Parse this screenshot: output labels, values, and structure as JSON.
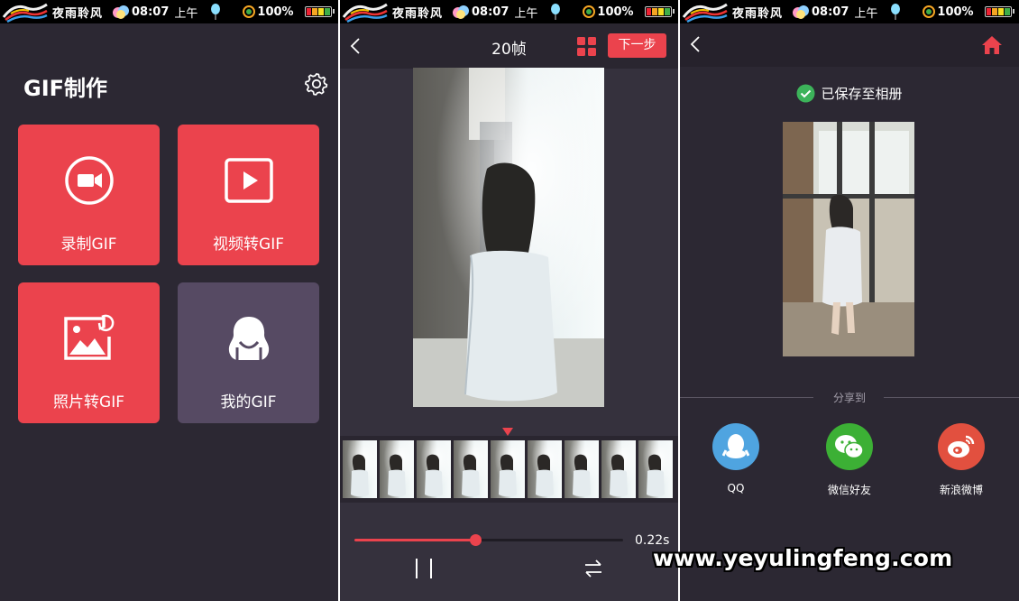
{
  "statusbar": {
    "title": "夜雨聆风",
    "time": "08:07",
    "ampm": "上午",
    "battery": "100%"
  },
  "home": {
    "title": "GIF制作",
    "tiles": [
      {
        "label": "录制GIF",
        "icon": "video-camera-icon"
      },
      {
        "label": "视频转GIF",
        "icon": "play-icon"
      },
      {
        "label": "照片转GIF",
        "icon": "photo-icon"
      },
      {
        "label": "我的GIF",
        "icon": "person-icon"
      }
    ],
    "colors": {
      "accent": "#eb434d",
      "tile_alt": "#564a63",
      "background": "#2c2833"
    }
  },
  "editor": {
    "title": "20帧",
    "next_label": "下一步",
    "speed": "0.22s",
    "slider_position": 0.45,
    "frame_count_visible": 9
  },
  "result": {
    "saved_text": "已保存至相册",
    "share_label": "分享到",
    "share_targets": [
      {
        "label": "QQ",
        "icon": "qq-penguin-icon",
        "color": "#4fa4e0"
      },
      {
        "label": "微信好友",
        "icon": "wechat-icon",
        "color": "#3cb035"
      },
      {
        "label": "新浪微博",
        "icon": "weibo-icon",
        "color": "#e2503f"
      }
    ]
  },
  "watermark": "www.yeyulingfeng.com"
}
